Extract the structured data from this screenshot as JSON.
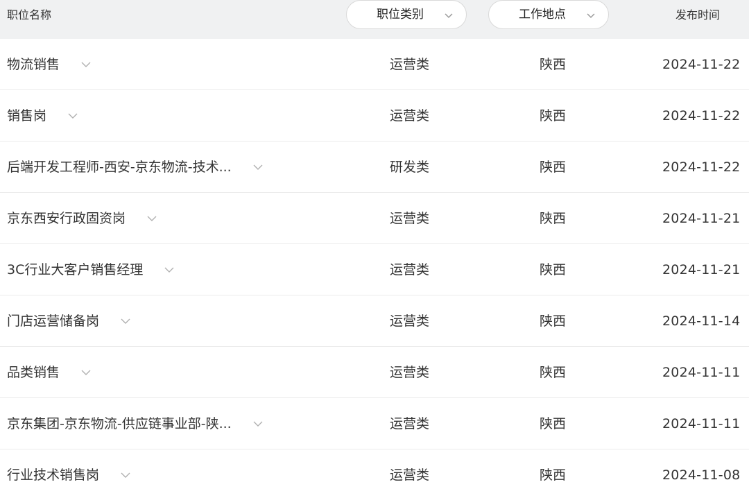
{
  "header": {
    "col_name": "职位名称",
    "filter_category": "职位类别",
    "filter_location": "工作地点",
    "col_date": "发布时间"
  },
  "icons": {
    "chevron": "chevron-down-icon",
    "chevron_color": "#b0b0b0"
  },
  "jobs": [
    {
      "title": "物流销售",
      "category": "运营类",
      "location": "陕西",
      "date": "2024-11-22"
    },
    {
      "title": "销售岗",
      "category": "运营类",
      "location": "陕西",
      "date": "2024-11-22"
    },
    {
      "title": "后端开发工程师-西安-京东物流-技术...",
      "category": "研发类",
      "location": "陕西",
      "date": "2024-11-22"
    },
    {
      "title": "京东西安行政固资岗",
      "category": "运营类",
      "location": "陕西",
      "date": "2024-11-21"
    },
    {
      "title": "3C行业大客户销售经理",
      "category": "运营类",
      "location": "陕西",
      "date": "2024-11-21"
    },
    {
      "title": "门店运营储备岗",
      "category": "运营类",
      "location": "陕西",
      "date": "2024-11-14"
    },
    {
      "title": "品类销售",
      "category": "运营类",
      "location": "陕西",
      "date": "2024-11-11"
    },
    {
      "title": "京东集团-京东物流-供应链事业部-陕...",
      "category": "运营类",
      "location": "陕西",
      "date": "2024-11-11"
    },
    {
      "title": "行业技术销售岗",
      "category": "运营类",
      "location": "陕西",
      "date": "2024-11-08"
    }
  ]
}
